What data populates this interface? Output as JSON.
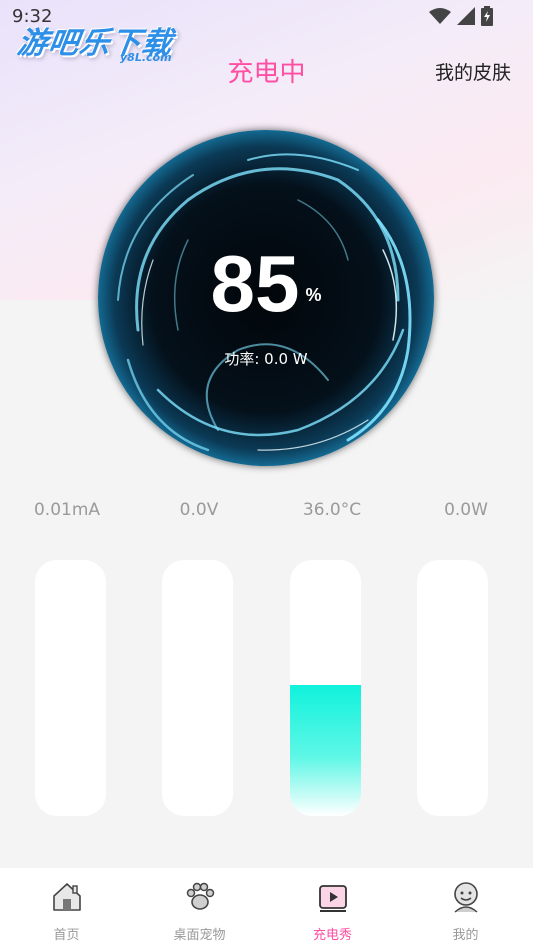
{
  "status_bar": {
    "time": "9:32"
  },
  "watermark": {
    "text": "游吧乐下载",
    "sub": "y8L.com"
  },
  "header": {
    "title": "充电中",
    "skin_label": "我的皮肤"
  },
  "orb": {
    "percent": "85",
    "percent_unit": "%",
    "power_text": "功率: 0.0 W"
  },
  "stats": [
    {
      "label": "0.01mA",
      "fill": 0
    },
    {
      "label": "0.0V",
      "fill": 0
    },
    {
      "label": "36.0°C",
      "fill": 0.51
    },
    {
      "label": "0.0W",
      "fill": 0
    }
  ],
  "colors": {
    "accent": "#ff4fa3",
    "fill_top": "#10f2dc",
    "fill_bottom": "#ffffff"
  },
  "tabs": [
    {
      "label": "首页",
      "icon": "home-icon",
      "active": false
    },
    {
      "label": "桌面宠物",
      "icon": "paw-icon",
      "active": false
    },
    {
      "label": "充电秀",
      "icon": "play-icon",
      "active": true
    },
    {
      "label": "我的",
      "icon": "profile-icon",
      "active": false
    }
  ]
}
